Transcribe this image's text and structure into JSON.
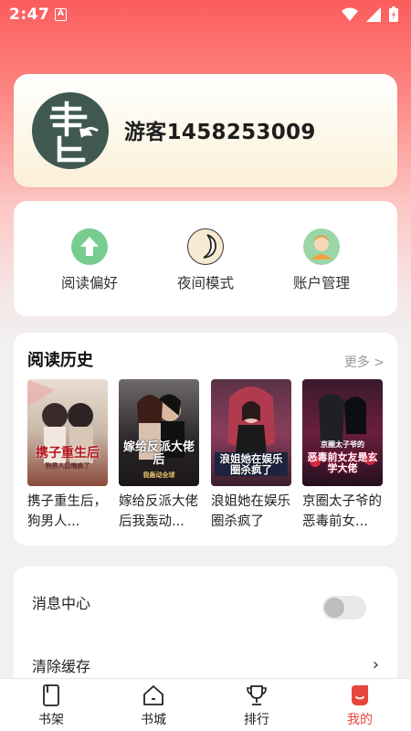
{
  "status_bar": {
    "time": "2:47",
    "notification_icon": "A"
  },
  "profile": {
    "username": "游客1458253009",
    "avatar_icon": "book-logo-avatar"
  },
  "quick_actions": [
    {
      "label": "阅读偏好",
      "icon": "arrow-up-icon",
      "color": "#6cc98a"
    },
    {
      "label": "夜间模式",
      "icon": "moon-icon",
      "color": "#f6ead3"
    },
    {
      "label": "账户管理",
      "icon": "user-icon",
      "color": "#8fd19e"
    }
  ],
  "history": {
    "title": "阅读历史",
    "more": "更多 >",
    "books": [
      {
        "title": "携子重生后，狗男人后悔了",
        "display_title": "携子重生后，狗男人...",
        "cover_text": "携子重生后",
        "cover_subtitle": "狗男人后悔疯了"
      },
      {
        "title": "嫁给反派大佬后我轰动全城",
        "display_title": "嫁给反派大佬后我轰动...",
        "cover_text": "嫁给反派大佬后",
        "cover_subtitle": "我轰动全球"
      },
      {
        "title": "浪姐她在娱乐圈杀疯了",
        "display_title": "浪姐她在娱乐圈杀疯了",
        "cover_text": "浪姐她在娱乐圈杀疯了",
        "cover_subtitle": ""
      },
      {
        "title": "京圈太子爷的恶毒前女友是玄学大佬",
        "display_title": "京圈太子爷的恶毒前女...",
        "cover_text": "恶毒前女友是玄学大佬",
        "cover_subtitle": "京圈太子爷的"
      }
    ]
  },
  "settings": {
    "message_center": "消息中心",
    "message_center_enabled": false,
    "clear_cache": "清除缓存",
    "chevron": "›"
  },
  "tabs": [
    {
      "label": "书架",
      "icon": "bookshelf-icon",
      "active": false
    },
    {
      "label": "书城",
      "icon": "bookstore-icon",
      "active": false
    },
    {
      "label": "排行",
      "icon": "trophy-icon",
      "active": false
    },
    {
      "label": "我的",
      "icon": "profile-icon",
      "active": true
    }
  ],
  "colors": {
    "accent": "#e8453c",
    "header_red": "#fb5c5c"
  }
}
